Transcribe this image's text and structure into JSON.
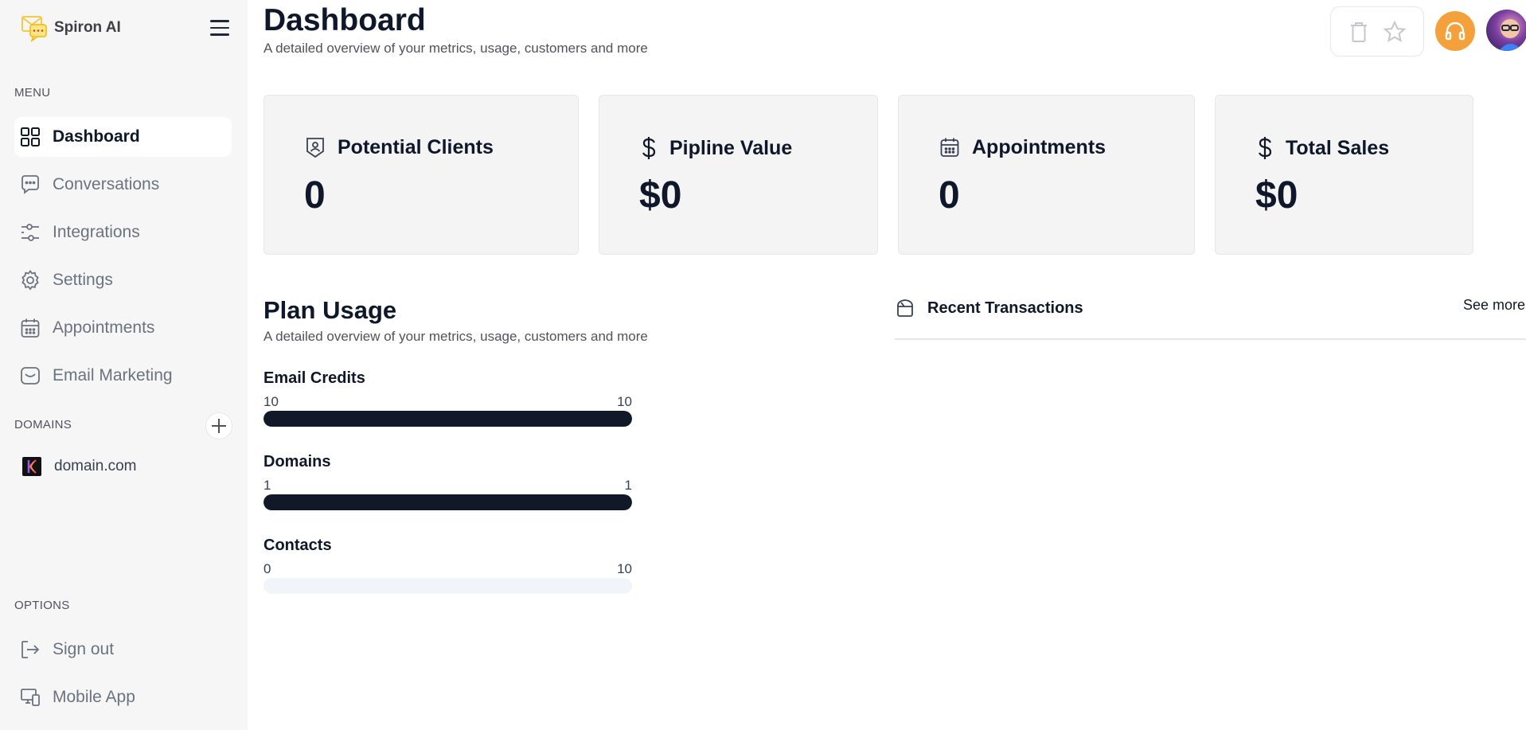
{
  "app": {
    "name": "Spiron AI"
  },
  "sidebar": {
    "menu_label": "MENU",
    "items": [
      {
        "label": "Dashboard",
        "icon": "dashboard-grid-icon",
        "active": true
      },
      {
        "label": "Conversations",
        "icon": "chat-bubble-icon",
        "active": false
      },
      {
        "label": "Integrations",
        "icon": "sliders-icon",
        "active": false
      },
      {
        "label": "Settings",
        "icon": "gear-icon",
        "active": false
      },
      {
        "label": "Appointments",
        "icon": "calendar-icon",
        "active": false
      },
      {
        "label": "Email Marketing",
        "icon": "mail-icon",
        "active": false
      }
    ],
    "domains_label": "DOMAINS",
    "domains": [
      {
        "label": "domain.com"
      }
    ],
    "options_label": "OPTIONS",
    "options": [
      {
        "label": "Sign out",
        "icon": "sign-out-icon"
      },
      {
        "label": "Mobile App",
        "icon": "devices-icon"
      }
    ]
  },
  "header": {
    "title": "Dashboard",
    "subtitle": "A detailed overview of your metrics, usage, customers and more"
  },
  "cards": [
    {
      "title": "Potential Clients",
      "value": "0",
      "icon": "person-badge-icon"
    },
    {
      "title": "Pipline Value",
      "value": "$0",
      "icon": "dollar-icon"
    },
    {
      "title": "Appointments",
      "value": "0",
      "icon": "calendar-icon"
    },
    {
      "title": "Total Sales",
      "value": "$0",
      "icon": "dollar-icon"
    }
  ],
  "plan_usage": {
    "title": "Plan Usage",
    "subtitle": "A detailed overview of your metrics, usage, customers and more",
    "items": [
      {
        "label": "Email Credits",
        "used": "10",
        "limit": "10",
        "fraction": 1.0
      },
      {
        "label": "Domains",
        "used": "1",
        "limit": "1",
        "fraction": 1.0
      },
      {
        "label": "Contacts",
        "used": "0",
        "limit": "10",
        "fraction": 0.0
      }
    ]
  },
  "transactions": {
    "title": "Recent Transactions",
    "see_more": "See more"
  },
  "colors": {
    "accent_orange": "#f5a13b",
    "bar_fill": "#111827",
    "sidebar_bg": "#f6f6f6",
    "card_bg": "#f4f4f5"
  }
}
